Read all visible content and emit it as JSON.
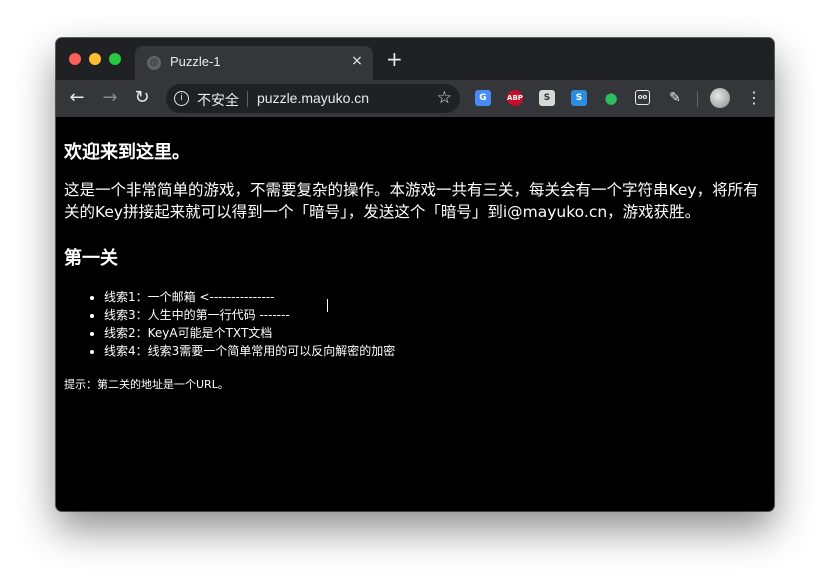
{
  "browser": {
    "tab_title": "Puzzle-1",
    "tab_close": "×",
    "new_tab": "+",
    "back": "←",
    "forward": "→",
    "reload": "↻",
    "info_icon": "i",
    "security_label": "不安全",
    "url": "puzzle.mayuko.cn",
    "star": "☆",
    "menu": "⋮",
    "extensions": [
      "translate-icon",
      "adblock-plus-icon",
      "s-extension-icon",
      "stylish-icon",
      "evernote-icon",
      "eyes-extension-icon",
      "pen-extension-icon"
    ]
  },
  "page": {
    "welcome_heading": "欢迎来到这里。",
    "intro": "这是一个非常简单的游戏，不需要复杂的操作。本游戏一共有三关，每关会有一个字符串Key，将所有关的Key拼接起来就可以得到一个「暗号」，发送这个「暗号」到i@mayuko.cn，游戏获胜。",
    "level_heading": "第一关",
    "clues": [
      "线索1：一个邮箱 <---------------",
      "线索3：人生中的第一行代码 -------",
      "线索2：KeyA可能是个TXT文档",
      "线索4：线索3需要一个简单常用的可以反向解密的加密"
    ],
    "hint": "提示：第二关的地址是一个URL。"
  }
}
